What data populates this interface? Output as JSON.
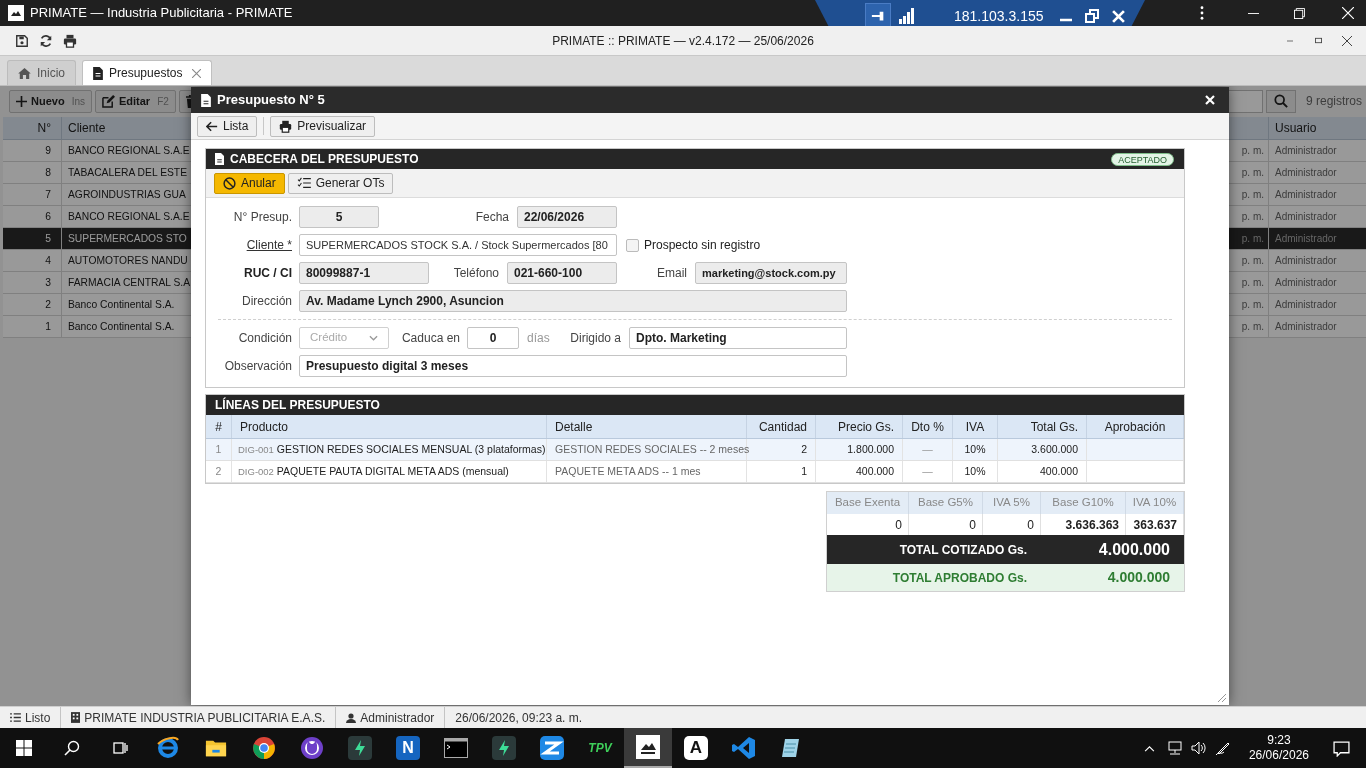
{
  "window": {
    "title": "PRIMATE — Industria Publicitaria - PRIMATE"
  },
  "remote_bar": {
    "address": "181.103.3.155"
  },
  "app_toolbar": {
    "title": "PRIMATE :: PRIMATE — v2.4.172 — 25/06/2026"
  },
  "tabs": [
    {
      "label": "Inicio",
      "selected": false,
      "closable": false
    },
    {
      "label": "Presupuestos",
      "selected": true,
      "closable": true
    }
  ],
  "list": {
    "buttons": [
      {
        "label": "Nuevo",
        "shortcut": "Ins",
        "kind": "new"
      },
      {
        "label": "Editar",
        "shortcut": "F2",
        "kind": "edit"
      },
      {
        "kind": "delete"
      }
    ],
    "record_count": "9 registros",
    "columns": {
      "number": "N°",
      "client": "Cliente",
      "user": "Usuario"
    },
    "rows": [
      {
        "number": "9",
        "client": "BANCO REGIONAL S.A.E",
        "time": "p. m.",
        "user": "Administrador",
        "selected": false
      },
      {
        "number": "8",
        "client": "TABACALERA DEL ESTE",
        "time": "p. m.",
        "user": "Administrador",
        "selected": false
      },
      {
        "number": "7",
        "client": "AGROINDUSTRIAS GUA",
        "time": "p. m.",
        "user": "Administrador",
        "selected": false
      },
      {
        "number": "6",
        "client": "BANCO REGIONAL S.A.E",
        "time": "p. m.",
        "user": "Administrador",
        "selected": false
      },
      {
        "number": "5",
        "client": "SUPERMERCADOS STO",
        "time": "p. m.",
        "user": "Administrador",
        "selected": true
      },
      {
        "number": "4",
        "client": "AUTOMOTORES NANDU",
        "time": "p. m.",
        "user": "Administrador",
        "selected": false
      },
      {
        "number": "3",
        "client": "FARMACIA CENTRAL S.A",
        "time": "p. m.",
        "user": "Administrador",
        "selected": false
      },
      {
        "number": "2",
        "client": "Banco Continental S.A.",
        "time": "p. m.",
        "user": "Administrador",
        "selected": false
      },
      {
        "number": "1",
        "client": "Banco Continental S.A.",
        "time": "p. m.",
        "user": "Administrador",
        "selected": false
      }
    ]
  },
  "modal": {
    "title": "Presupuesto N° 5",
    "toolbar": [
      {
        "label": "Lista",
        "kind": "back"
      },
      {
        "label": "Previsualizar",
        "kind": "print"
      }
    ],
    "header_section": {
      "title": "CABECERA DEL PRESUPUESTO",
      "status": "ACEPTADO",
      "actions": [
        {
          "label": "Anular",
          "kind": "warning"
        },
        {
          "label": "Generar OTs",
          "kind": "default"
        }
      ],
      "number": {
        "label": "N° Presup.",
        "value": "5"
      },
      "date": {
        "label": "Fecha",
        "value": "22/06/2026"
      },
      "client": {
        "label": "Cliente *",
        "value": "SUPERMERCADOS STOCK S.A. / Stock Supermercados [80"
      },
      "prospect": {
        "label": "Prospecto sin registro",
        "checked": false
      },
      "ruc": {
        "label": "RUC / CI",
        "value": "80099887-1"
      },
      "phone": {
        "label": "Teléfono",
        "value": "021-660-100"
      },
      "email": {
        "label": "Email",
        "value": "marketing@stock.com.py"
      },
      "address": {
        "label": "Dirección",
        "value": "Av. Madame Lynch 2900, Asuncion"
      },
      "condition": {
        "label": "Condición",
        "value": "Crédito",
        "disabled": true
      },
      "expires": {
        "label": "Caduca en",
        "value": "0",
        "unit": "días"
      },
      "addressed_to": {
        "label": "Dirigido a",
        "value": "Dpto. Marketing"
      },
      "observation": {
        "label": "Observación",
        "value": "Presupuesto digital 3 meses"
      }
    },
    "lines_section": {
      "title": "LÍNEAS DEL PRESUPUESTO",
      "columns": [
        "#",
        "Producto",
        "Detalle",
        "Cantidad",
        "Precio Gs.",
        "Dto %",
        "IVA",
        "Total Gs.",
        "Aprobación"
      ],
      "rows": [
        {
          "index": "1",
          "code": "DIG-001",
          "product": "GESTION REDES SOCIALES MENSUAL (3 plataformas)",
          "detail": "GESTION REDES SOCIALES -- 2 meses",
          "quantity": "2",
          "price": "1.800.000",
          "discount": "—",
          "iva": "10%",
          "total": "3.600.000",
          "selected": true
        },
        {
          "index": "2",
          "code": "DIG-002",
          "product": "PAQUETE PAUTA DIGITAL META ADS (mensual)",
          "detail": "PAQUETE META ADS -- 1 mes",
          "quantity": "1",
          "price": "400.000",
          "discount": "—",
          "iva": "10%",
          "total": "400.000",
          "selected": false
        }
      ]
    },
    "totals": {
      "columns": [
        "Base Exenta",
        "Base G5%",
        "IVA 5%",
        "Base G10%",
        "IVA 10%"
      ],
      "values": [
        "0",
        "0",
        "0",
        "3.636.363",
        "363.637"
      ],
      "quoted": {
        "label": "TOTAL COTIZADO Gs.",
        "value": "4.000.000"
      },
      "approved": {
        "label": "TOTAL APROBADO Gs.",
        "value": "4.000.000"
      }
    }
  },
  "status_bar": [
    {
      "kind": "list",
      "text": "Listo"
    },
    {
      "kind": "building",
      "text": "PRIMATE INDUSTRIA PUBLICITARIA E.A.S."
    },
    {
      "kind": "user",
      "text": "Administrador"
    },
    {
      "kind": "plain",
      "text": "26/06/2026, 09:23 a. m."
    }
  ],
  "taskbar": {
    "apps": [
      {
        "kind": "browser"
      },
      {
        "kind": "folder"
      },
      {
        "kind": "chrome"
      },
      {
        "kind": "octo"
      },
      {
        "kind": "bolt"
      },
      {
        "kind": "letter",
        "glyph": "N"
      },
      {
        "kind": "terminal"
      },
      {
        "kind": "bolt"
      },
      {
        "kind": "stack"
      },
      {
        "kind": "text",
        "glyph": "TPV"
      },
      {
        "kind": "primate",
        "active": true
      },
      {
        "kind": "letter_dark",
        "glyph": "A"
      },
      {
        "kind": "code"
      },
      {
        "kind": "notepad"
      }
    ],
    "time": "9:23",
    "date": "26/06/2026"
  }
}
